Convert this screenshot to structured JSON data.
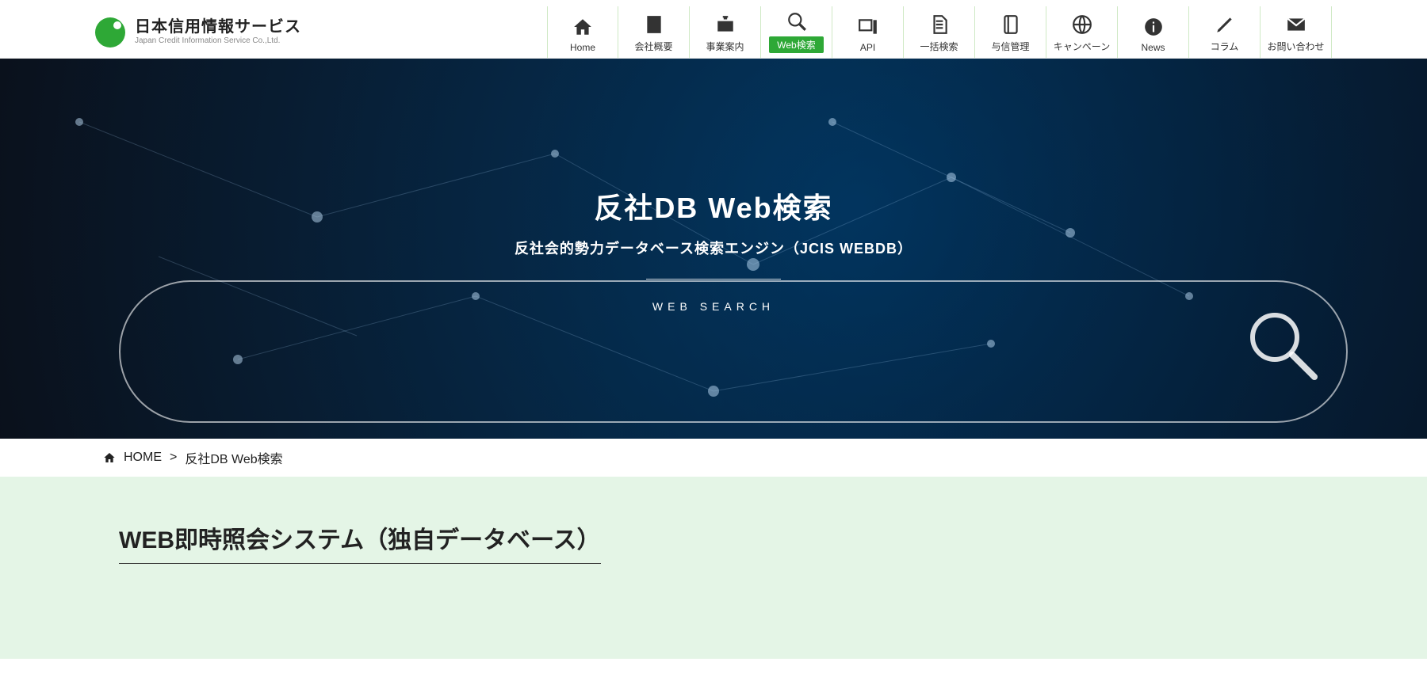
{
  "brand": {
    "jp": "日本信用情報サービス",
    "en": "Japan Credit Information Service Co.,Ltd."
  },
  "nav": {
    "items": [
      {
        "label": "Home",
        "icon": "home"
      },
      {
        "label": "会社概要",
        "icon": "building"
      },
      {
        "label": "事業案内",
        "icon": "briefcase"
      },
      {
        "label": "Web検索",
        "icon": "search",
        "active": true
      },
      {
        "label": "API",
        "icon": "monitor"
      },
      {
        "label": "一括検索",
        "icon": "docs"
      },
      {
        "label": "与信管理",
        "icon": "book"
      },
      {
        "label": "キャンペーン",
        "icon": "globe"
      },
      {
        "label": "News",
        "icon": "info"
      },
      {
        "label": "コラム",
        "icon": "pen"
      },
      {
        "label": "お問い合わせ",
        "icon": "mail"
      }
    ]
  },
  "hero": {
    "title": "反社DB Web検索",
    "subtitle": "反社会的勢力データベース検索エンジン（JCIS WEBDB）",
    "tag": "WEB SEARCH"
  },
  "breadcrumb": {
    "home": "HOME",
    "sep": ">",
    "current": "反社DB Web検索"
  },
  "section": {
    "heading": "WEB即時照会システム（独自データベース）"
  }
}
